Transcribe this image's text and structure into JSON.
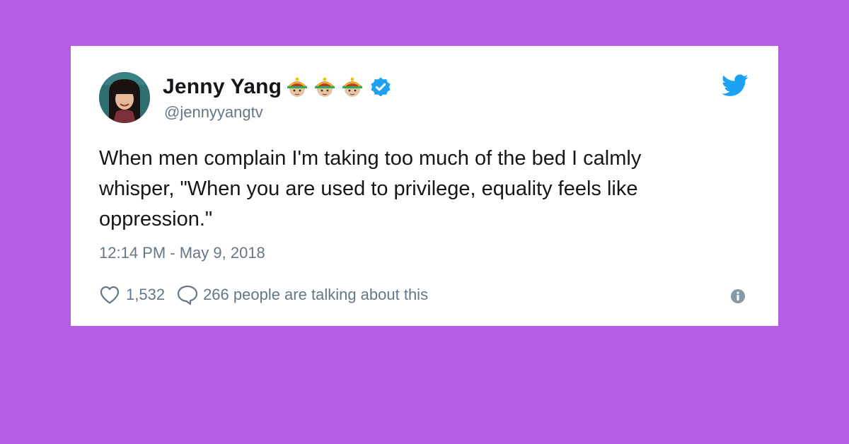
{
  "tweet": {
    "display_name": "Jenny Yang",
    "handle": "@jennyyangtv",
    "name_emojis": [
      "emoji-person-icon",
      "emoji-person-icon",
      "emoji-person-icon"
    ],
    "verified": true,
    "text": "When men complain I'm taking too much of the bed I calmly\nwhisper, \"When you are used to privilege, equality feels like\noppression.\"",
    "timestamp": "12:14 PM - May 9, 2018",
    "like_count": "1,532",
    "talking_text": "266 people are talking about this"
  },
  "colors": {
    "background": "#b55ee3",
    "card": "#ffffff",
    "twitter_blue": "#1da1f2",
    "text": "#14171a",
    "secondary_text": "#657786"
  },
  "icons": {
    "brand": "twitter-bird-icon",
    "verified": "verified-badge-icon",
    "like": "heart-icon",
    "reply": "reply-bubble-icon",
    "info": "info-icon"
  }
}
